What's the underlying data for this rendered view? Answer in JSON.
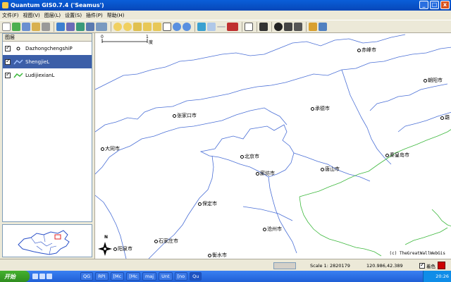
{
  "window": {
    "title": "Quantum GIS0.7.4 ('Seamus')",
    "minimize": "_",
    "maximize": "□",
    "close": "x"
  },
  "menu": [
    "文件(F)",
    "视图(V)",
    "图层(L)",
    "设置(S)",
    "插件(P)",
    "帮助(H)"
  ],
  "layers": {
    "header": "图层",
    "items": [
      {
        "name": "DazhongchengshiP",
        "checked": true,
        "selected": false,
        "symbol": "point"
      },
      {
        "name": "ShengjieL",
        "checked": true,
        "selected": true,
        "symbol": "line"
      },
      {
        "name": "LudijiexianL",
        "checked": true,
        "selected": false,
        "symbol": "line"
      }
    ]
  },
  "map": {
    "scalebar": {
      "start": "0",
      "end": "1",
      "unit": "度"
    },
    "cities": [
      {
        "name": "赤峰市"
      },
      {
        "name": "朝阳市"
      },
      {
        "name": "张家口市"
      },
      {
        "name": "承德市"
      },
      {
        "name": "大同市"
      },
      {
        "name": "北京市"
      },
      {
        "name": "秦皇岛市"
      },
      {
        "name": "廊坊市"
      },
      {
        "name": "唐山市"
      },
      {
        "name": "保定市"
      },
      {
        "name": "沧州市"
      },
      {
        "name": "石家庄市"
      },
      {
        "name": "阳泉市"
      },
      {
        "name": "衡水市"
      },
      {
        "name": "葫"
      }
    ],
    "copyright": "(c) TheGreatWallWebGis",
    "north_label": "N",
    "colors": {
      "province_border": "#4a6fd6",
      "coastline": "#3cb83c"
    }
  },
  "status": {
    "scale": "Scale 1: 2820179",
    "coords": "120.986,42.389",
    "render_label": "着色",
    "render_checked": true
  },
  "taskbar": {
    "start": "开始",
    "tasks": [
      "QG",
      "RPI",
      "[Mc",
      "[Mc",
      "maj",
      "Unt",
      "[no",
      "Qu"
    ],
    "active_task": "Qu",
    "clock": "20:26"
  }
}
